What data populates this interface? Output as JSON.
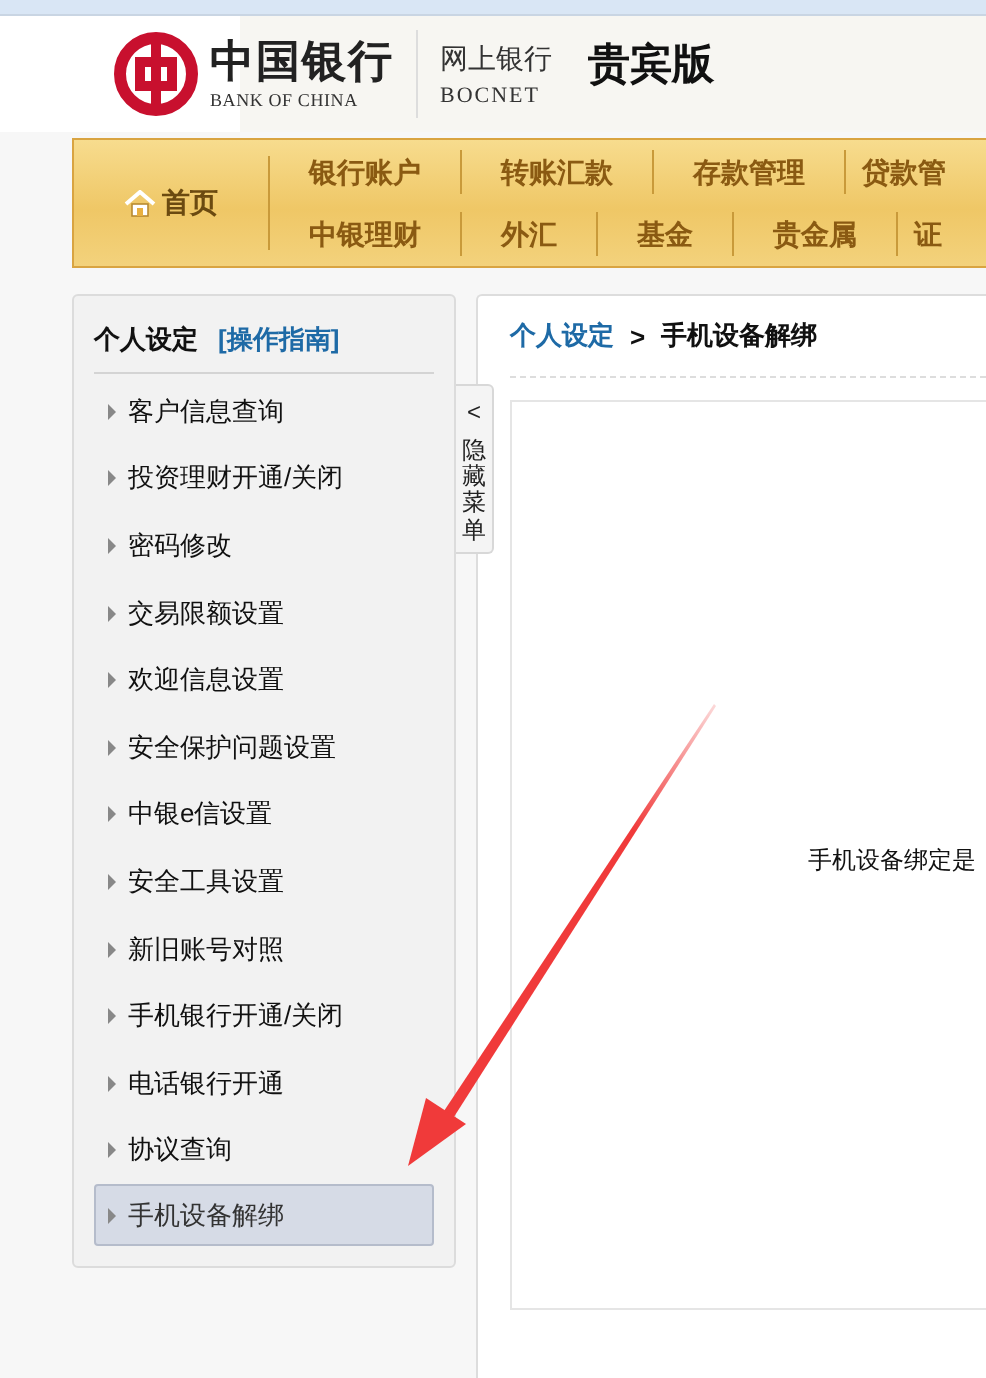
{
  "header": {
    "logo_cn": "中国银行",
    "logo_en": "BANK OF CHINA",
    "product_cn": "网上银行",
    "product_en": "BOCNET",
    "edition": "贵宾版"
  },
  "nav": {
    "home": "首页",
    "upper_menu": [
      "银行账户",
      "转账汇款",
      "存款管理",
      "贷款管"
    ],
    "lower_menu": [
      "中银理财",
      "外汇",
      "基金",
      "贵金属",
      "证"
    ]
  },
  "sidebar": {
    "title": "个人设定",
    "guide_link": "[操作指南]",
    "items": [
      {
        "label": "客户信息查询",
        "selected": false
      },
      {
        "label": "投资理财开通/关闭",
        "selected": false
      },
      {
        "label": "密码修改",
        "selected": false
      },
      {
        "label": "交易限额设置",
        "selected": false
      },
      {
        "label": "欢迎信息设置",
        "selected": false
      },
      {
        "label": "安全保护问题设置",
        "selected": false
      },
      {
        "label": "中银e信设置",
        "selected": false
      },
      {
        "label": "安全工具设置",
        "selected": false
      },
      {
        "label": "新旧账号对照",
        "selected": false
      },
      {
        "label": "手机银行开通/关闭",
        "selected": false
      },
      {
        "label": "电话银行开通",
        "selected": false
      },
      {
        "label": "协议查询",
        "selected": false
      },
      {
        "label": "手机设备解绑",
        "selected": true
      }
    ]
  },
  "hide_menu": {
    "arrow": "<",
    "label": "隐藏菜单"
  },
  "breadcrumb": {
    "parent": "个人设定",
    "separator": ">",
    "current": "手机设备解绑"
  },
  "content": {
    "message": "手机设备绑定是"
  },
  "annotations": [
    {
      "kind": "arrow"
    }
  ]
}
